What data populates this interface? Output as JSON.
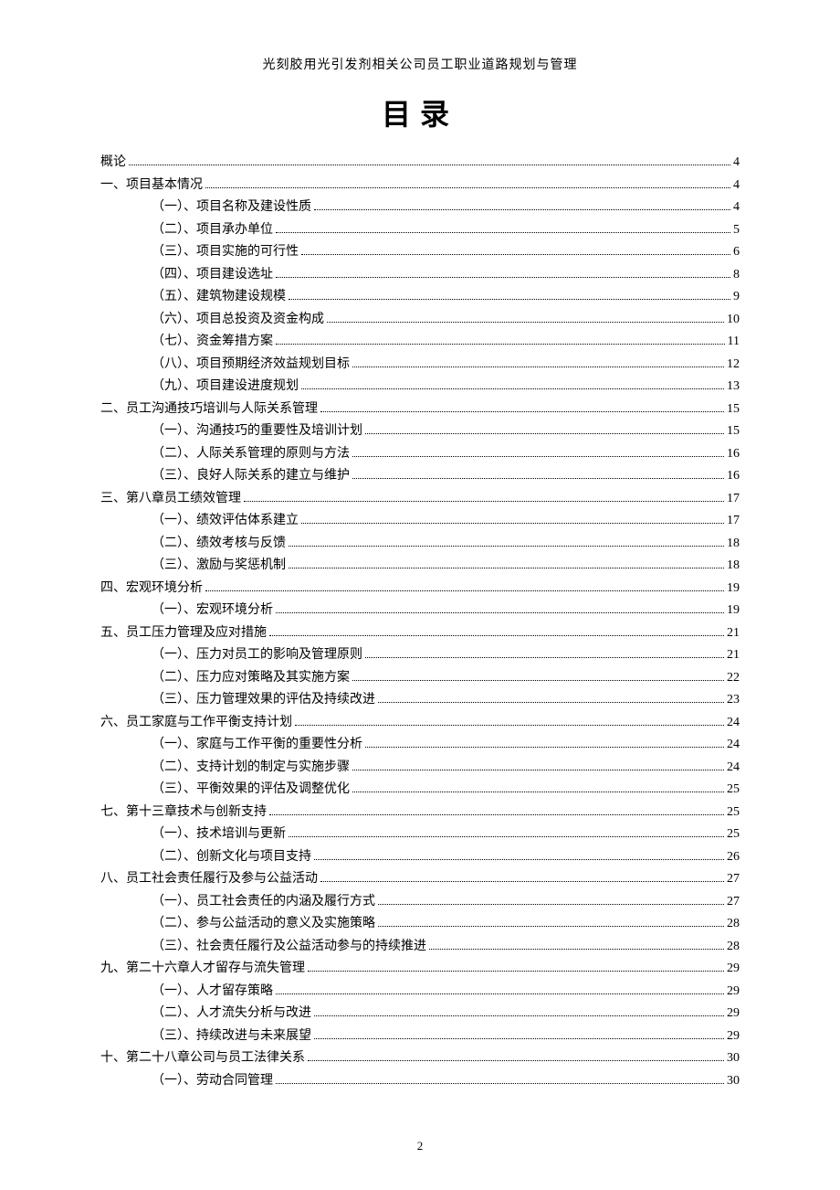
{
  "header": "光刻胶用光引发剂相关公司员工职业道路规划与管理",
  "toc_title": "目录",
  "page_number": "2",
  "toc": [
    {
      "level": 0,
      "label": "概论",
      "page": "4"
    },
    {
      "level": 1,
      "label": "一、项目基本情况",
      "page": "4"
    },
    {
      "level": 2,
      "label": "（一）、项目名称及建设性质",
      "page": "4"
    },
    {
      "level": 2,
      "label": "（二）、项目承办单位",
      "page": "5"
    },
    {
      "level": 2,
      "label": "（三）、项目实施的可行性",
      "page": "6"
    },
    {
      "level": 2,
      "label": "（四）、项目建设选址",
      "page": "8"
    },
    {
      "level": 2,
      "label": "（五）、建筑物建设规模",
      "page": "9"
    },
    {
      "level": 2,
      "label": "（六）、项目总投资及资金构成",
      "page": "10"
    },
    {
      "level": 2,
      "label": "（七）、资金筹措方案",
      "page": "11"
    },
    {
      "level": 2,
      "label": "（八）、项目预期经济效益规划目标",
      "page": "12"
    },
    {
      "level": 2,
      "label": "（九）、项目建设进度规划",
      "page": "13"
    },
    {
      "level": 1,
      "label": "二、员工沟通技巧培训与人际关系管理",
      "page": "15"
    },
    {
      "level": 2,
      "label": "（一）、沟通技巧的重要性及培训计划",
      "page": "15"
    },
    {
      "level": 2,
      "label": "（二）、人际关系管理的原则与方法",
      "page": "16"
    },
    {
      "level": 2,
      "label": "（三）、良好人际关系的建立与维护",
      "page": "16"
    },
    {
      "level": 1,
      "label": "三、第八章员工绩效管理",
      "page": "17"
    },
    {
      "level": 2,
      "label": "（一）、绩效评估体系建立",
      "page": "17"
    },
    {
      "level": 2,
      "label": "（二）、绩效考核与反馈",
      "page": "18"
    },
    {
      "level": 2,
      "label": "（三）、激励与奖惩机制",
      "page": "18"
    },
    {
      "level": 1,
      "label": "四、宏观环境分析",
      "page": "19"
    },
    {
      "level": 2,
      "label": "（一）、宏观环境分析",
      "page": "19"
    },
    {
      "level": 1,
      "label": "五、员工压力管理及应对措施",
      "page": "21"
    },
    {
      "level": 2,
      "label": "（一）、压力对员工的影响及管理原则",
      "page": "21"
    },
    {
      "level": 2,
      "label": "（二）、压力应对策略及其实施方案",
      "page": "22"
    },
    {
      "level": 2,
      "label": "（三）、压力管理效果的评估及持续改进",
      "page": "23"
    },
    {
      "level": 1,
      "label": "六、员工家庭与工作平衡支持计划",
      "page": "24"
    },
    {
      "level": 2,
      "label": "（一）、家庭与工作平衡的重要性分析",
      "page": "24"
    },
    {
      "level": 2,
      "label": "（二）、支持计划的制定与实施步骤",
      "page": "24"
    },
    {
      "level": 2,
      "label": "（三）、平衡效果的评估及调整优化",
      "page": "25"
    },
    {
      "level": 1,
      "label": "七、第十三章技术与创新支持",
      "page": "25"
    },
    {
      "level": 2,
      "label": "（一）、技术培训与更新",
      "page": "25"
    },
    {
      "level": 2,
      "label": "（二）、创新文化与项目支持",
      "page": "26"
    },
    {
      "level": 1,
      "label": "八、员工社会责任履行及参与公益活动",
      "page": "27"
    },
    {
      "level": 2,
      "label": "（一）、员工社会责任的内涵及履行方式",
      "page": "27"
    },
    {
      "level": 2,
      "label": "（二）、参与公益活动的意义及实施策略",
      "page": "28"
    },
    {
      "level": 2,
      "label": "（三）、社会责任履行及公益活动参与的持续推进",
      "page": "28"
    },
    {
      "level": 1,
      "label": "九、第二十六章人才留存与流失管理",
      "page": "29"
    },
    {
      "level": 2,
      "label": "（一）、人才留存策略",
      "page": "29"
    },
    {
      "level": 2,
      "label": "（二）、人才流失分析与改进",
      "page": "29"
    },
    {
      "level": 2,
      "label": "（三）、持续改进与未来展望",
      "page": "29"
    },
    {
      "level": 1,
      "label": "十、第二十八章公司与员工法律关系",
      "page": "30"
    },
    {
      "level": 2,
      "label": "（一）、劳动合同管理",
      "page": "30"
    }
  ]
}
